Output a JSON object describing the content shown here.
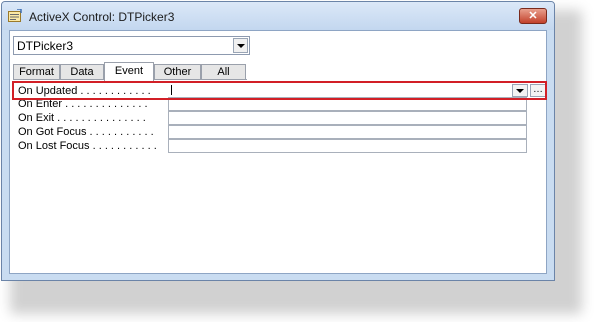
{
  "window": {
    "title": "ActiveX Control: DTPicker3",
    "close_glyph": "✕"
  },
  "selector": {
    "value": "DTPicker3"
  },
  "tabs": [
    {
      "label": "Format",
      "active": false
    },
    {
      "label": "Data",
      "active": false
    },
    {
      "label": "Event",
      "active": true
    },
    {
      "label": "Other",
      "active": false
    },
    {
      "label": "All",
      "active": false
    }
  ],
  "properties": [
    {
      "label": "On Updated . . . . . . . . . . . .",
      "value": "",
      "selected": true
    },
    {
      "label": "On Enter . . . . . . . . . . . . . .",
      "value": "",
      "selected": false
    },
    {
      "label": "On Exit . . . . . . . . . . . . . . .",
      "value": "",
      "selected": false
    },
    {
      "label": "On Got Focus . . . . . . . . . . .",
      "value": "",
      "selected": false
    },
    {
      "label": "On Lost Focus . . . . . . . . . . .",
      "value": "",
      "selected": false
    }
  ],
  "build_button": "…",
  "colors": {
    "highlight": "#d21f26",
    "titlebar": "#c9dcf1"
  },
  "icons": [
    "property-sheet-icon",
    "close-icon",
    "dropdown-arrow-icon",
    "build-ellipsis-icon"
  ]
}
